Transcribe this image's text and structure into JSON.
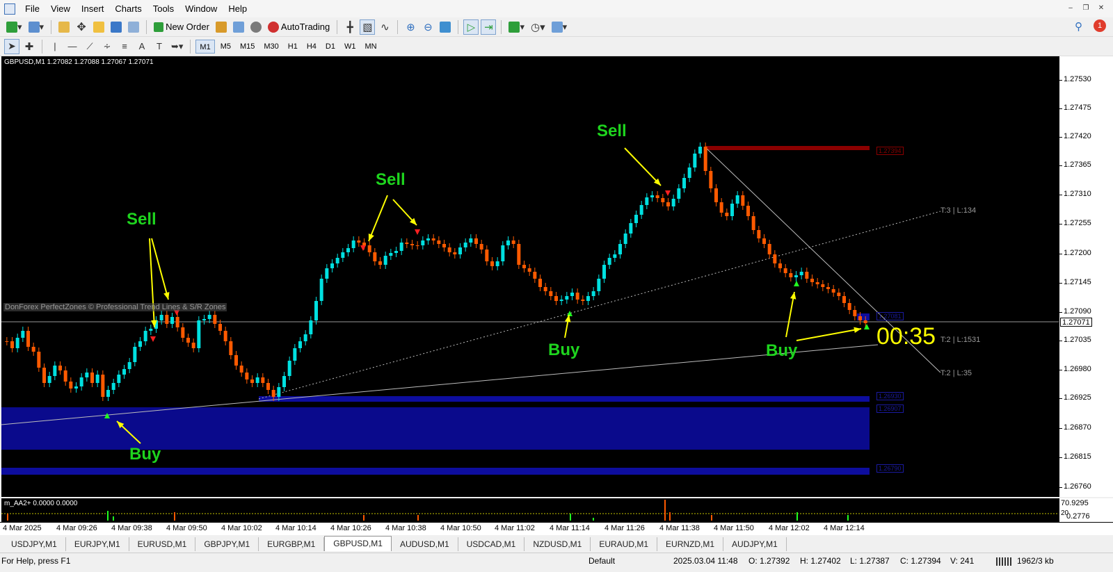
{
  "menu": [
    "File",
    "View",
    "Insert",
    "Charts",
    "Tools",
    "Window",
    "Help"
  ],
  "toolbar": {
    "new_order": "New Order",
    "autotrading": "AutoTrading"
  },
  "timeframes": [
    "M1",
    "M5",
    "M15",
    "M30",
    "H1",
    "H4",
    "D1",
    "W1",
    "MN"
  ],
  "active_timeframe": "M1",
  "chart": {
    "header": "GBPUSD,M1  1.27082 1.27088 1.27067 1.27071",
    "watermark": "DonForex PerfectZones © Professional Trend Lines & S/R Zones",
    "countdown": "00:35",
    "current_price": "1.27071",
    "annotations": {
      "sell1": "Sell",
      "sell2": "Sell",
      "sell3": "Sell",
      "buy1": "Buy",
      "buy2": "Buy",
      "buy3": "Buy"
    },
    "trend_labels": {
      "t3": "T:3 | L:134",
      "t2a": "T:2 | L:1531",
      "t2b": "T:2 | L:35"
    },
    "zone_labels": {
      "red": "1.27394",
      "blue_top": "1.26930",
      "blue_mid": "1.26907",
      "blue_low": "1.26790",
      "small_blue": "1.27081"
    },
    "colors": {
      "bull": "#00e0e0",
      "bear": "#ff5a00",
      "zone_blue": "#0a0a8c",
      "zone_red": "#8b0000",
      "annotation_text": "#1ed41e",
      "arrows": "#ffff00"
    }
  },
  "price_axis": [
    "1.27530",
    "1.27475",
    "1.27420",
    "1.27365",
    "1.27310",
    "1.27255",
    "1.27200",
    "1.27145",
    "1.27090",
    "1.27035",
    "1.26980",
    "1.26925",
    "1.26870",
    "1.26815",
    "1.26760"
  ],
  "indicator": {
    "label": "m_AA2+ 0.0000 0.0000",
    "axis_top": "70.9295",
    "axis_mid": "20",
    "axis_low": "0.2776"
  },
  "time_axis": [
    "4 Mar 2025",
    "4 Mar 09:26",
    "4 Mar 09:38",
    "4 Mar 09:50",
    "4 Mar 10:02",
    "4 Mar 10:14",
    "4 Mar 10:26",
    "4 Mar 10:38",
    "4 Mar 10:50",
    "4 Mar 11:02",
    "4 Mar 11:14",
    "4 Mar 11:26",
    "4 Mar 11:38",
    "4 Mar 11:50",
    "4 Mar 12:02",
    "4 Mar 12:14"
  ],
  "tabs": [
    "USDJPY,M1",
    "EURJPY,M1",
    "EURUSD,M1",
    "GBPJPY,M1",
    "EURGBP,M1",
    "GBPUSD,M1",
    "AUDUSD,M1",
    "USDCAD,M1",
    "NZDUSD,M1",
    "EURAUD,M1",
    "EURNZD,M1",
    "AUDJPY,M1"
  ],
  "active_tab": "GBPUSD,M1",
  "status": {
    "help": "For Help, press F1",
    "profile": "Default",
    "datetime": "2025.03.04 11:48",
    "open": "O: 1.27392",
    "high": "H: 1.27402",
    "low": "L: 1.27387",
    "close": "C: 1.27394",
    "volume": "V: 241",
    "traffic": "1962/3 kb"
  },
  "notification_count": "1"
}
